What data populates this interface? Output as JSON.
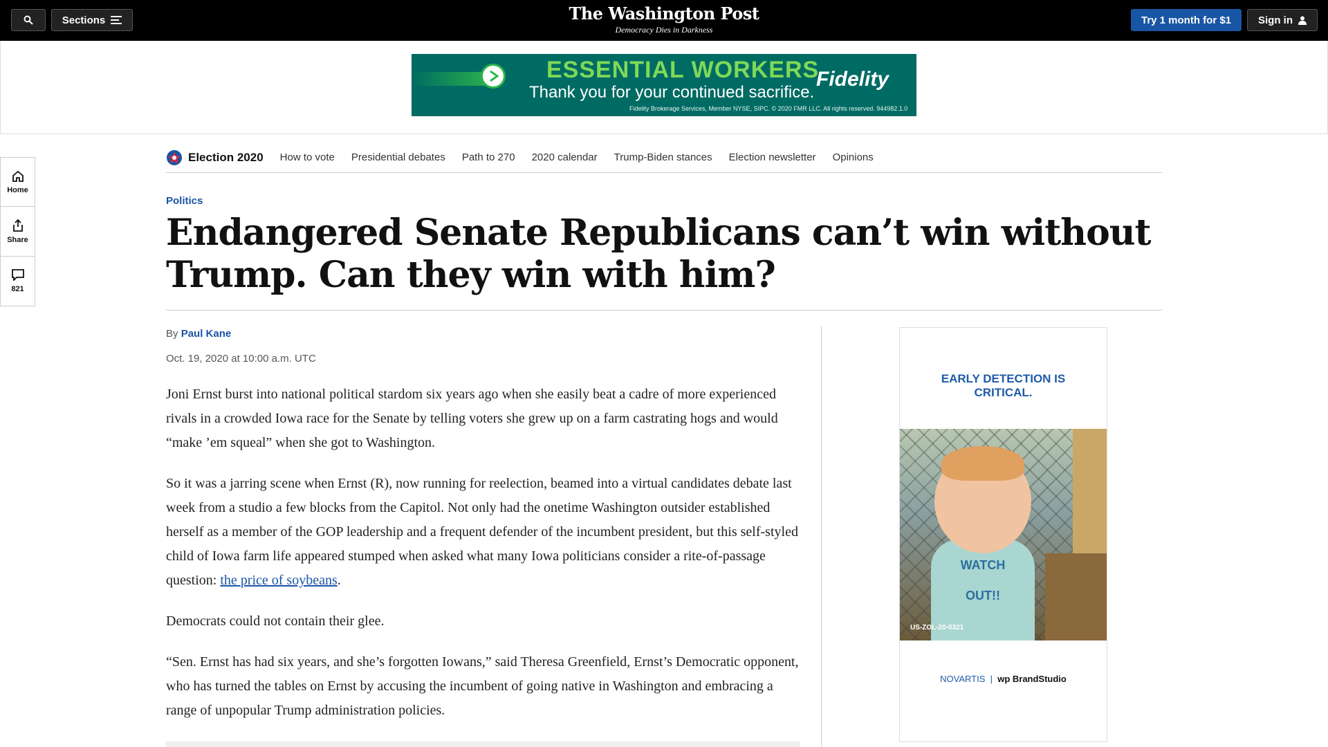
{
  "topbar": {
    "search_icon": "search-icon",
    "sections_label": "Sections",
    "masthead_title": "The Washington Post",
    "masthead_tagline": "Democracy Dies in Darkness",
    "try_label": "Try 1 month for $1",
    "signin_label": "Sign in"
  },
  "top_ad": {
    "headline": "ESSENTIAL WORKERS",
    "subline": "Thank you for your continued sacrifice.",
    "brand": "Fidelity",
    "fineprint": "Fidelity Brokerage Services, Member NYSE, SIPC. © 2020 FMR LLC. All rights reserved. 944982.1.0"
  },
  "rail": {
    "home_label": "Home",
    "share_label": "Share",
    "comments_count": "821"
  },
  "election_nav": {
    "title": "Election 2020",
    "items": [
      "How to vote",
      "Presidential debates",
      "Path to 270",
      "2020 calendar",
      "Trump-Biden stances",
      "Election newsletter",
      "Opinions"
    ]
  },
  "article": {
    "kicker": "Politics",
    "headline": "Endangered Senate Republicans can’t win without Trump. Can they win with him?",
    "by_prefix": "By",
    "author": "Paul Kane",
    "dateline": "Oct. 19, 2020 at 10:00 a.m. UTC",
    "p1": "Joni Ernst burst into national political stardom six years ago when she easily beat a cadre of more experienced rivals in a crowded Iowa race for the Senate by telling voters she grew up on a farm castrating hogs and would “make ’em squeal” when she got to Washington.",
    "p2_before": "So it was a jarring scene when Ernst (R), now running for reelection, beamed into a virtual candidates debate last week from a studio a few blocks from the Capitol. Not only had the onetime Washington outsider established herself as a member of the GOP leadership and a frequent defender of the incumbent president, but this self-styled child of Iowa farm life appeared stumped when asked what many Iowa politicians consider a rite-of-passage question: ",
    "p2_link": "the price of soybeans",
    "p2_after": ".",
    "p3": "Democrats could not contain their glee.",
    "p4": "“Sen. Ernst has had six years, and she’s forgotten Iowans,” said Theresa Greenfield, Ernst’s Democratic opponent, who has turned the tables on Ernst by accusing the incumbent of going native in Washington and embracing a range of unpopular Trump administration policies."
  },
  "side_ad": {
    "headline_line1": "EARLY DETECTION IS",
    "headline_line2": "CRITICAL.",
    "shirt_line1": "WATCH",
    "shirt_line2": "OUT!!",
    "code": "US-ZOL-20-0321",
    "logo_novartis": "NOVARTIS",
    "logo_wp": "wp BrandStudio"
  },
  "colors": {
    "accent": "#1955a5",
    "topbar": "#000000",
    "ad_green": "#006b63"
  }
}
